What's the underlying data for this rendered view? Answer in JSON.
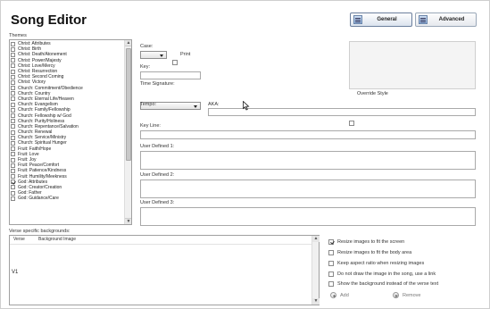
{
  "window": {
    "title": "Song Editor"
  },
  "tabs": [
    {
      "label": "General",
      "icon": "general-tab-icon",
      "active": true
    },
    {
      "label": "Advanced",
      "icon": "advanced-tab-icon",
      "active": false
    }
  ],
  "themes": {
    "label": "Themes",
    "items": [
      {
        "label": "Christ: Attributes",
        "checked": false
      },
      {
        "label": "Christ: Birth",
        "checked": false
      },
      {
        "label": "Christ: Death/Atonement",
        "checked": false
      },
      {
        "label": "Christ: Power/Majesty",
        "checked": false
      },
      {
        "label": "Christ: Love/Mercy",
        "checked": false
      },
      {
        "label": "Christ: Resurrection",
        "checked": false
      },
      {
        "label": "Christ: Second Coming",
        "checked": false
      },
      {
        "label": "Christ: Victory",
        "checked": false
      },
      {
        "label": "Church: Commitment/Obedience",
        "checked": false
      },
      {
        "label": "Church: Country",
        "checked": false
      },
      {
        "label": "Church: Eternal Life/Heaven",
        "checked": false
      },
      {
        "label": "Church: Evangelism",
        "checked": false
      },
      {
        "label": "Church: Family/Fellowship",
        "checked": false
      },
      {
        "label": "Church: Fellowship w/ God",
        "checked": false
      },
      {
        "label": "Church: Purity/Holiness",
        "checked": false
      },
      {
        "label": "Church: Repentance/Salvation",
        "checked": false
      },
      {
        "label": "Church: Renewal",
        "checked": false
      },
      {
        "label": "Church: Service/Ministry",
        "checked": false
      },
      {
        "label": "Church: Spiritual Hunger",
        "checked": false
      },
      {
        "label": "Fruit: Faith/Hope",
        "checked": false
      },
      {
        "label": "Fruit: Love",
        "checked": false
      },
      {
        "label": "Fruit: Joy",
        "checked": false
      },
      {
        "label": "Fruit: Peace/Comfort",
        "checked": false
      },
      {
        "label": "Fruit: Patience/Kindness",
        "checked": false
      },
      {
        "label": "Fruit: Humility/Meekness",
        "checked": false
      },
      {
        "label": "God: Attributes",
        "checked": true
      },
      {
        "label": "God: Creator/Creation",
        "checked": false
      },
      {
        "label": "God: Father",
        "checked": false
      },
      {
        "label": "God: Guidance/Care",
        "checked": false
      }
    ]
  },
  "fields": {
    "case_label": "Case:",
    "print_label": "Print",
    "key_label": "Key:",
    "time_signature_label": "Time Signature:",
    "tempo_label": "Tempo:",
    "aka_label": "AKA:",
    "key_line_label": "Key Line:",
    "user_defined_1_label": "User Defined 1:",
    "user_defined_2_label": "User Defined 2:",
    "user_defined_3_label": "User Defined 3:",
    "override_style_label": "Override Style"
  },
  "backgrounds": {
    "label": "Verse specific backgrounds:",
    "columns": [
      "Verse",
      "Background Image"
    ],
    "rows": [
      {
        "verse": "V1",
        "image": ""
      }
    ]
  },
  "options": [
    {
      "label": "Resize images to fit the screen",
      "checked": true
    },
    {
      "label": "Resize images to fit the body area",
      "checked": false
    },
    {
      "label": "Keep aspect ratio when resizing images",
      "checked": false
    },
    {
      "label": "Do not draw the image in the song, use a link",
      "checked": false
    },
    {
      "label": "Show the background instead of the verse text",
      "checked": false
    }
  ],
  "actions": {
    "add_label": "Add",
    "remove_label": "Remove"
  }
}
